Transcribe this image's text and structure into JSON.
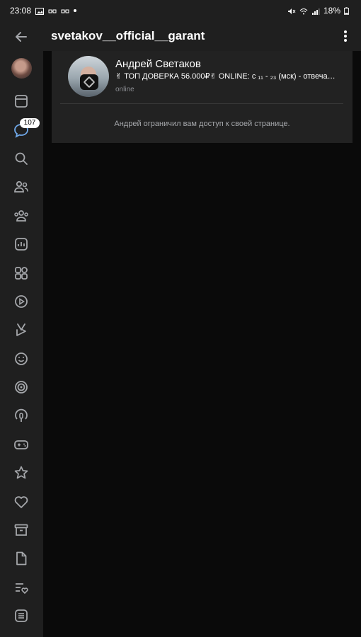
{
  "status_bar": {
    "time": "23:08",
    "battery": "18%"
  },
  "header": {
    "title": "svetakov__official__garant"
  },
  "sidebar": {
    "messages_badge": "107",
    "items": [
      "profile-avatar",
      "news",
      "messages",
      "search",
      "friends",
      "communities",
      "statistics",
      "services",
      "video",
      "clips",
      "stickers",
      "vk-play",
      "podcasts",
      "games",
      "bookmarks",
      "liked",
      "archive",
      "documents",
      "wishlist",
      "settings"
    ]
  },
  "profile": {
    "name": "Андрей Светаков",
    "status": "✌ ТОП ДОВЕРКА 56.000₽✌ ONLINE: с ₁₁ - ₂₃ (мск) - отвечаю …",
    "online": "online",
    "restricted_message": "Андрей ограничил вам доступ к своей странице."
  },
  "colors": {
    "background": "#0a0a0a",
    "panel": "#1f1f1f",
    "card": "#222222",
    "text": "#ffffff",
    "muted": "#8a8c91"
  }
}
